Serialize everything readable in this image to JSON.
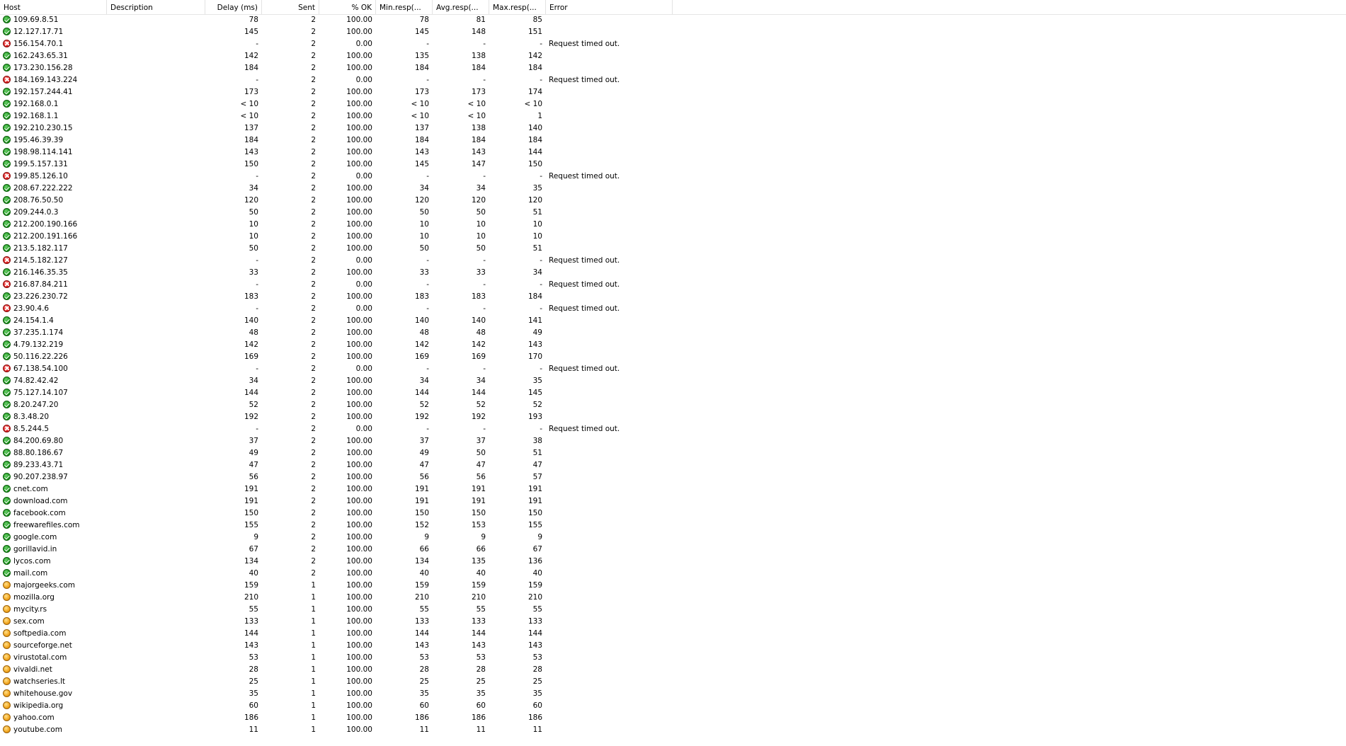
{
  "columns": [
    {
      "key": "host",
      "label": "Host"
    },
    {
      "key": "description",
      "label": "Description"
    },
    {
      "key": "delay",
      "label": "Delay (ms)"
    },
    {
      "key": "sent",
      "label": "Sent"
    },
    {
      "key": "pct_ok",
      "label": "% OK"
    },
    {
      "key": "min",
      "label": "Min.resp(..."
    },
    {
      "key": "avg",
      "label": "Avg.resp(..."
    },
    {
      "key": "max",
      "label": "Max.resp(..."
    },
    {
      "key": "error",
      "label": "Error"
    },
    {
      "key": "blank",
      "label": ""
    }
  ],
  "status_icons": {
    "ok": "green-check-icon",
    "fail": "red-x-icon",
    "warn": "orange-dot-icon"
  },
  "rows": [
    {
      "status": "ok",
      "host": "109.69.8.51",
      "description": "",
      "delay": "78",
      "sent": "2",
      "pct_ok": "100.00",
      "min": "78",
      "avg": "81",
      "max": "85",
      "error": ""
    },
    {
      "status": "ok",
      "host": "12.127.17.71",
      "description": "",
      "delay": "145",
      "sent": "2",
      "pct_ok": "100.00",
      "min": "145",
      "avg": "148",
      "max": "151",
      "error": ""
    },
    {
      "status": "fail",
      "host": "156.154.70.1",
      "description": "",
      "delay": "-",
      "sent": "2",
      "pct_ok": "0.00",
      "min": "-",
      "avg": "-",
      "max": "-",
      "error": "Request timed out."
    },
    {
      "status": "ok",
      "host": "162.243.65.31",
      "description": "",
      "delay": "142",
      "sent": "2",
      "pct_ok": "100.00",
      "min": "135",
      "avg": "138",
      "max": "142",
      "error": ""
    },
    {
      "status": "ok",
      "host": "173.230.156.28",
      "description": "",
      "delay": "184",
      "sent": "2",
      "pct_ok": "100.00",
      "min": "184",
      "avg": "184",
      "max": "184",
      "error": ""
    },
    {
      "status": "fail",
      "host": "184.169.143.224",
      "description": "",
      "delay": "-",
      "sent": "2",
      "pct_ok": "0.00",
      "min": "-",
      "avg": "-",
      "max": "-",
      "error": "Request timed out."
    },
    {
      "status": "ok",
      "host": "192.157.244.41",
      "description": "",
      "delay": "173",
      "sent": "2",
      "pct_ok": "100.00",
      "min": "173",
      "avg": "173",
      "max": "174",
      "error": ""
    },
    {
      "status": "ok",
      "host": "192.168.0.1",
      "description": "",
      "delay": "< 10",
      "sent": "2",
      "pct_ok": "100.00",
      "min": "< 10",
      "avg": "< 10",
      "max": "< 10",
      "error": ""
    },
    {
      "status": "ok",
      "host": "192.168.1.1",
      "description": "",
      "delay": "< 10",
      "sent": "2",
      "pct_ok": "100.00",
      "min": "< 10",
      "avg": "< 10",
      "max": "1",
      "error": ""
    },
    {
      "status": "ok",
      "host": "192.210.230.15",
      "description": "",
      "delay": "137",
      "sent": "2",
      "pct_ok": "100.00",
      "min": "137",
      "avg": "138",
      "max": "140",
      "error": ""
    },
    {
      "status": "ok",
      "host": "195.46.39.39",
      "description": "",
      "delay": "184",
      "sent": "2",
      "pct_ok": "100.00",
      "min": "184",
      "avg": "184",
      "max": "184",
      "error": ""
    },
    {
      "status": "ok",
      "host": "198.98.114.141",
      "description": "",
      "delay": "143",
      "sent": "2",
      "pct_ok": "100.00",
      "min": "143",
      "avg": "143",
      "max": "144",
      "error": ""
    },
    {
      "status": "ok",
      "host": "199.5.157.131",
      "description": "",
      "delay": "150",
      "sent": "2",
      "pct_ok": "100.00",
      "min": "145",
      "avg": "147",
      "max": "150",
      "error": ""
    },
    {
      "status": "fail",
      "host": "199.85.126.10",
      "description": "",
      "delay": "-",
      "sent": "2",
      "pct_ok": "0.00",
      "min": "-",
      "avg": "-",
      "max": "-",
      "error": "Request timed out."
    },
    {
      "status": "ok",
      "host": "208.67.222.222",
      "description": "",
      "delay": "34",
      "sent": "2",
      "pct_ok": "100.00",
      "min": "34",
      "avg": "34",
      "max": "35",
      "error": ""
    },
    {
      "status": "ok",
      "host": "208.76.50.50",
      "description": "",
      "delay": "120",
      "sent": "2",
      "pct_ok": "100.00",
      "min": "120",
      "avg": "120",
      "max": "120",
      "error": ""
    },
    {
      "status": "ok",
      "host": "209.244.0.3",
      "description": "",
      "delay": "50",
      "sent": "2",
      "pct_ok": "100.00",
      "min": "50",
      "avg": "50",
      "max": "51",
      "error": ""
    },
    {
      "status": "ok",
      "host": "212.200.190.166",
      "description": "",
      "delay": "10",
      "sent": "2",
      "pct_ok": "100.00",
      "min": "10",
      "avg": "10",
      "max": "10",
      "error": ""
    },
    {
      "status": "ok",
      "host": "212.200.191.166",
      "description": "",
      "delay": "10",
      "sent": "2",
      "pct_ok": "100.00",
      "min": "10",
      "avg": "10",
      "max": "10",
      "error": ""
    },
    {
      "status": "ok",
      "host": "213.5.182.117",
      "description": "",
      "delay": "50",
      "sent": "2",
      "pct_ok": "100.00",
      "min": "50",
      "avg": "50",
      "max": "51",
      "error": ""
    },
    {
      "status": "fail",
      "host": "214.5.182.127",
      "description": "",
      "delay": "-",
      "sent": "2",
      "pct_ok": "0.00",
      "min": "-",
      "avg": "-",
      "max": "-",
      "error": "Request timed out."
    },
    {
      "status": "ok",
      "host": "216.146.35.35",
      "description": "",
      "delay": "33",
      "sent": "2",
      "pct_ok": "100.00",
      "min": "33",
      "avg": "33",
      "max": "34",
      "error": ""
    },
    {
      "status": "fail",
      "host": "216.87.84.211",
      "description": "",
      "delay": "-",
      "sent": "2",
      "pct_ok": "0.00",
      "min": "-",
      "avg": "-",
      "max": "-",
      "error": "Request timed out."
    },
    {
      "status": "ok",
      "host": "23.226.230.72",
      "description": "",
      "delay": "183",
      "sent": "2",
      "pct_ok": "100.00",
      "min": "183",
      "avg": "183",
      "max": "184",
      "error": ""
    },
    {
      "status": "fail",
      "host": "23.90.4.6",
      "description": "",
      "delay": "-",
      "sent": "2",
      "pct_ok": "0.00",
      "min": "-",
      "avg": "-",
      "max": "-",
      "error": "Request timed out."
    },
    {
      "status": "ok",
      "host": "24.154.1.4",
      "description": "",
      "delay": "140",
      "sent": "2",
      "pct_ok": "100.00",
      "min": "140",
      "avg": "140",
      "max": "141",
      "error": ""
    },
    {
      "status": "ok",
      "host": "37.235.1.174",
      "description": "",
      "delay": "48",
      "sent": "2",
      "pct_ok": "100.00",
      "min": "48",
      "avg": "48",
      "max": "49",
      "error": ""
    },
    {
      "status": "ok",
      "host": "4.79.132.219",
      "description": "",
      "delay": "142",
      "sent": "2",
      "pct_ok": "100.00",
      "min": "142",
      "avg": "142",
      "max": "143",
      "error": ""
    },
    {
      "status": "ok",
      "host": "50.116.22.226",
      "description": "",
      "delay": "169",
      "sent": "2",
      "pct_ok": "100.00",
      "min": "169",
      "avg": "169",
      "max": "170",
      "error": ""
    },
    {
      "status": "fail",
      "host": "67.138.54.100",
      "description": "",
      "delay": "-",
      "sent": "2",
      "pct_ok": "0.00",
      "min": "-",
      "avg": "-",
      "max": "-",
      "error": "Request timed out."
    },
    {
      "status": "ok",
      "host": "74.82.42.42",
      "description": "",
      "delay": "34",
      "sent": "2",
      "pct_ok": "100.00",
      "min": "34",
      "avg": "34",
      "max": "35",
      "error": ""
    },
    {
      "status": "ok",
      "host": "75.127.14.107",
      "description": "",
      "delay": "144",
      "sent": "2",
      "pct_ok": "100.00",
      "min": "144",
      "avg": "144",
      "max": "145",
      "error": ""
    },
    {
      "status": "ok",
      "host": "8.20.247.20",
      "description": "",
      "delay": "52",
      "sent": "2",
      "pct_ok": "100.00",
      "min": "52",
      "avg": "52",
      "max": "52",
      "error": ""
    },
    {
      "status": "ok",
      "host": "8.3.48.20",
      "description": "",
      "delay": "192",
      "sent": "2",
      "pct_ok": "100.00",
      "min": "192",
      "avg": "192",
      "max": "193",
      "error": ""
    },
    {
      "status": "fail",
      "host": "8.5.244.5",
      "description": "",
      "delay": "-",
      "sent": "2",
      "pct_ok": "0.00",
      "min": "-",
      "avg": "-",
      "max": "-",
      "error": "Request timed out."
    },
    {
      "status": "ok",
      "host": "84.200.69.80",
      "description": "",
      "delay": "37",
      "sent": "2",
      "pct_ok": "100.00",
      "min": "37",
      "avg": "37",
      "max": "38",
      "error": ""
    },
    {
      "status": "ok",
      "host": "88.80.186.67",
      "description": "",
      "delay": "49",
      "sent": "2",
      "pct_ok": "100.00",
      "min": "49",
      "avg": "50",
      "max": "51",
      "error": ""
    },
    {
      "status": "ok",
      "host": "89.233.43.71",
      "description": "",
      "delay": "47",
      "sent": "2",
      "pct_ok": "100.00",
      "min": "47",
      "avg": "47",
      "max": "47",
      "error": ""
    },
    {
      "status": "ok",
      "host": "90.207.238.97",
      "description": "",
      "delay": "56",
      "sent": "2",
      "pct_ok": "100.00",
      "min": "56",
      "avg": "56",
      "max": "57",
      "error": ""
    },
    {
      "status": "ok",
      "host": "cnet.com",
      "description": "",
      "delay": "191",
      "sent": "2",
      "pct_ok": "100.00",
      "min": "191",
      "avg": "191",
      "max": "191",
      "error": ""
    },
    {
      "status": "ok",
      "host": "download.com",
      "description": "",
      "delay": "191",
      "sent": "2",
      "pct_ok": "100.00",
      "min": "191",
      "avg": "191",
      "max": "191",
      "error": ""
    },
    {
      "status": "ok",
      "host": "facebook.com",
      "description": "",
      "delay": "150",
      "sent": "2",
      "pct_ok": "100.00",
      "min": "150",
      "avg": "150",
      "max": "150",
      "error": ""
    },
    {
      "status": "ok",
      "host": "freewarefiles.com",
      "description": "",
      "delay": "155",
      "sent": "2",
      "pct_ok": "100.00",
      "min": "152",
      "avg": "153",
      "max": "155",
      "error": ""
    },
    {
      "status": "ok",
      "host": "google.com",
      "description": "",
      "delay": "9",
      "sent": "2",
      "pct_ok": "100.00",
      "min": "9",
      "avg": "9",
      "max": "9",
      "error": ""
    },
    {
      "status": "ok",
      "host": "gorillavid.in",
      "description": "",
      "delay": "67",
      "sent": "2",
      "pct_ok": "100.00",
      "min": "66",
      "avg": "66",
      "max": "67",
      "error": ""
    },
    {
      "status": "ok",
      "host": "lycos.com",
      "description": "",
      "delay": "134",
      "sent": "2",
      "pct_ok": "100.00",
      "min": "134",
      "avg": "135",
      "max": "136",
      "error": ""
    },
    {
      "status": "ok",
      "host": "mail.com",
      "description": "",
      "delay": "40",
      "sent": "2",
      "pct_ok": "100.00",
      "min": "40",
      "avg": "40",
      "max": "40",
      "error": ""
    },
    {
      "status": "warn",
      "host": "majorgeeks.com",
      "description": "",
      "delay": "159",
      "sent": "1",
      "pct_ok": "100.00",
      "min": "159",
      "avg": "159",
      "max": "159",
      "error": ""
    },
    {
      "status": "warn",
      "host": "mozilla.org",
      "description": "",
      "delay": "210",
      "sent": "1",
      "pct_ok": "100.00",
      "min": "210",
      "avg": "210",
      "max": "210",
      "error": ""
    },
    {
      "status": "warn",
      "host": "mycity.rs",
      "description": "",
      "delay": "55",
      "sent": "1",
      "pct_ok": "100.00",
      "min": "55",
      "avg": "55",
      "max": "55",
      "error": ""
    },
    {
      "status": "warn",
      "host": "sex.com",
      "description": "",
      "delay": "133",
      "sent": "1",
      "pct_ok": "100.00",
      "min": "133",
      "avg": "133",
      "max": "133",
      "error": ""
    },
    {
      "status": "warn",
      "host": "softpedia.com",
      "description": "",
      "delay": "144",
      "sent": "1",
      "pct_ok": "100.00",
      "min": "144",
      "avg": "144",
      "max": "144",
      "error": ""
    },
    {
      "status": "warn",
      "host": "sourceforge.net",
      "description": "",
      "delay": "143",
      "sent": "1",
      "pct_ok": "100.00",
      "min": "143",
      "avg": "143",
      "max": "143",
      "error": ""
    },
    {
      "status": "warn",
      "host": "virustotal.com",
      "description": "",
      "delay": "53",
      "sent": "1",
      "pct_ok": "100.00",
      "min": "53",
      "avg": "53",
      "max": "53",
      "error": ""
    },
    {
      "status": "warn",
      "host": "vivaldi.net",
      "description": "",
      "delay": "28",
      "sent": "1",
      "pct_ok": "100.00",
      "min": "28",
      "avg": "28",
      "max": "28",
      "error": ""
    },
    {
      "status": "warn",
      "host": "watchseries.lt",
      "description": "",
      "delay": "25",
      "sent": "1",
      "pct_ok": "100.00",
      "min": "25",
      "avg": "25",
      "max": "25",
      "error": ""
    },
    {
      "status": "warn",
      "host": "whitehouse.gov",
      "description": "",
      "delay": "35",
      "sent": "1",
      "pct_ok": "100.00",
      "min": "35",
      "avg": "35",
      "max": "35",
      "error": ""
    },
    {
      "status": "warn",
      "host": "wikipedia.org",
      "description": "",
      "delay": "60",
      "sent": "1",
      "pct_ok": "100.00",
      "min": "60",
      "avg": "60",
      "max": "60",
      "error": ""
    },
    {
      "status": "warn",
      "host": "yahoo.com",
      "description": "",
      "delay": "186",
      "sent": "1",
      "pct_ok": "100.00",
      "min": "186",
      "avg": "186",
      "max": "186",
      "error": ""
    },
    {
      "status": "warn",
      "host": "youtube.com",
      "description": "",
      "delay": "11",
      "sent": "1",
      "pct_ok": "100.00",
      "min": "11",
      "avg": "11",
      "max": "11",
      "error": ""
    }
  ]
}
